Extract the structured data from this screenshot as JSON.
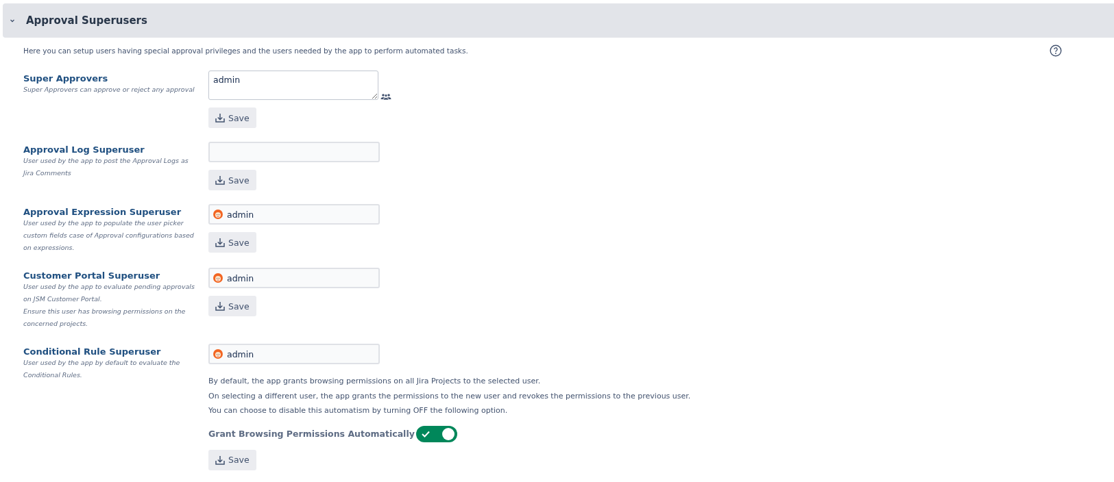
{
  "panel": {
    "title": "Approval Superusers",
    "expanded": true,
    "intro": "Here you can setup users having special approval privileges and the users needed by the app to perform automated tasks."
  },
  "sections": [
    {
      "kind": "textarea",
      "title": "Super Approvers",
      "help": [
        "Super Approvers can approve or reject any approval"
      ],
      "value": "admin",
      "save": "Save"
    },
    {
      "kind": "text",
      "title": "Approval Log Superuser",
      "help": [
        "User used by the app to post the Approval Logs as Jira Comments"
      ],
      "save": "Save"
    },
    {
      "kind": "user",
      "title": "Approval Expression Superuser",
      "help": [
        "User used by the app to populate the user picker custom fields case of Approval configurations based on expressions."
      ],
      "value": "admin",
      "save": "Save"
    },
    {
      "kind": "user",
      "title": "Customer Portal Superuser",
      "help": [
        "User used by the app to evaluate pending approvals on JSM Customer Portal.",
        "Ensure this user has browsing permissions on the concerned projects."
      ],
      "value": "admin",
      "save": "Save"
    },
    {
      "kind": "user",
      "title": "Conditional Rule Superuser",
      "help": [
        "User used by the app by default to evaluate the Conditional Rules."
      ],
      "value": "admin",
      "notes": [
        "By default, the app grants browsing permissions on all Jira Projects to the selected user.",
        "On selecting a different user, the app grants the permissions to the new user and revokes the permissions to the previous user.",
        "You can choose to disable this automatism by turning OFF the following option."
      ],
      "toggle": {
        "label": "Grant Browsing Permissions Automatically",
        "on": true
      },
      "save": "Save"
    }
  ]
}
